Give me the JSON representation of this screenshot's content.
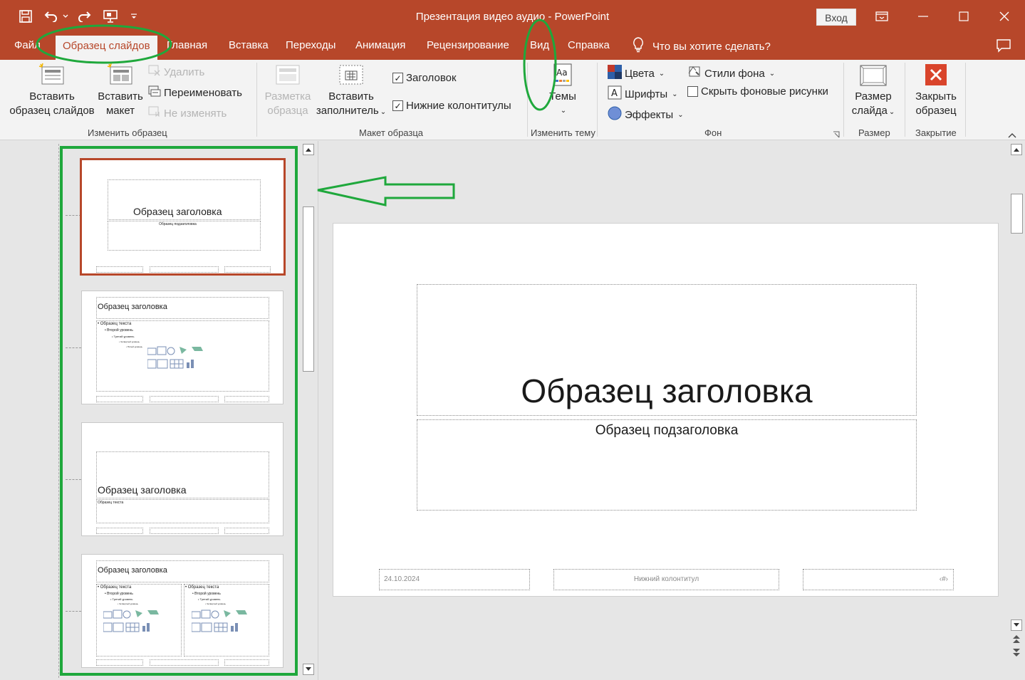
{
  "window": {
    "title": "Презентация видео аудио  -  PowerPoint",
    "signin_label": "Вход"
  },
  "tabs": [
    {
      "label": "Файл"
    },
    {
      "label": "Образец слайдов"
    },
    {
      "label": "Главная"
    },
    {
      "label": "Вставка"
    },
    {
      "label": "Переходы"
    },
    {
      "label": "Анимация"
    },
    {
      "label": "Рецензирование"
    },
    {
      "label": "Вид"
    },
    {
      "label": "Справка"
    }
  ],
  "tell_me": "Что вы хотите сделать?",
  "ribbon": {
    "edit_master": {
      "insert_master_label": "Вставить образец слайдов",
      "insert_master_line1": "Вставить",
      "insert_master_line2": "образец слайдов",
      "insert_layout_line1": "Вставить",
      "insert_layout_line2": "макет",
      "delete_label": "Удалить",
      "rename_label": "Переименовать",
      "preserve_label": "Не изменять",
      "group_label": "Изменить образец"
    },
    "master_layout": {
      "markup_line1": "Разметка",
      "markup_line2": "образца",
      "placeholder_line1": "Вставить",
      "placeholder_line2": "заполнитель",
      "title_label": "Заголовок",
      "title_checked": true,
      "footers_label": "Нижние колонтитулы",
      "footers_checked": true,
      "group_label": "Макет образца"
    },
    "edit_theme": {
      "themes_label": "Темы",
      "group_label": "Изменить тему"
    },
    "background": {
      "colors_label": "Цвета",
      "fonts_label": "Шрифты",
      "effects_label": "Эффекты",
      "bg_styles_label": "Стили фона",
      "hide_bg_label": "Скрыть фоновые рисунки",
      "hide_bg_checked": false,
      "group_label": "Фон"
    },
    "size": {
      "slide_size_line1": "Размер",
      "slide_size_line2": "слайда",
      "group_label": "Размер"
    },
    "close": {
      "close_line1": "Закрыть",
      "close_line2": "образец",
      "group_label": "Закрытие"
    }
  },
  "thumbnails": [
    {
      "title": "Образец заголовка",
      "subtitle": "Образец подзаголовка"
    },
    {
      "title": "Образец заголовка",
      "body": [
        "• Образец текста",
        "• Второй уровень",
        "• Третий уровень",
        "• Четвертый уровень",
        "• Пятый уровень"
      ]
    },
    {
      "title": "Образец заголовка",
      "body_small": "Образец текста"
    },
    {
      "title": "Образец заголовка",
      "body": [
        "• Образец текста",
        "• Второй уровень",
        "• Третий уровень",
        "• Четвертый уровень"
      ]
    }
  ],
  "slide": {
    "title": "Образец заголовка",
    "subtitle": "Образец подзаголовка",
    "date": "24.10.2024",
    "footer": "Нижний колонтитул",
    "page_number": "‹#›"
  },
  "colors": {
    "accent": "#b7472a",
    "annotation": "#1fa83c"
  }
}
